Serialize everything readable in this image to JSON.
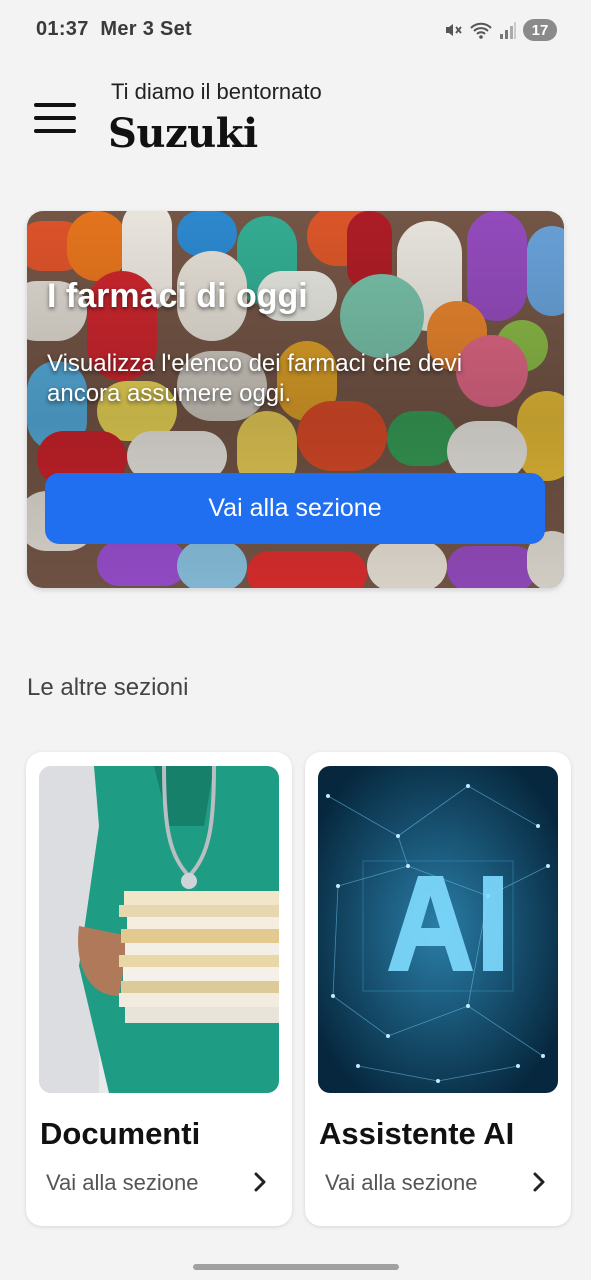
{
  "status_bar": {
    "time": "01:37",
    "date": "Mer 3 Set",
    "battery": "17",
    "icons": [
      "mute-icon",
      "wifi-icon",
      "signal-icon",
      "battery-icon"
    ]
  },
  "header": {
    "greeting": "Ti diamo il bentornato",
    "user_name": "Suzuki",
    "menu_icon": "hamburger-menu-icon"
  },
  "hero": {
    "title": "I farmaci di oggi",
    "description": "Visualizza l'elenco dei farmaci che devi ancora assumere oggi.",
    "button_label": "Vai alla sezione",
    "image": "pills-photo",
    "button_color": "#1f6ff0"
  },
  "other_sections": {
    "label": "Le altre sezioni",
    "cards": [
      {
        "title": "Documenti",
        "link_label": "Vai alla sezione",
        "image": "doctor-with-documents-photo"
      },
      {
        "title": "Assistente AI",
        "link_label": "Vai alla sezione",
        "image": "ai-network-photo"
      }
    ]
  }
}
